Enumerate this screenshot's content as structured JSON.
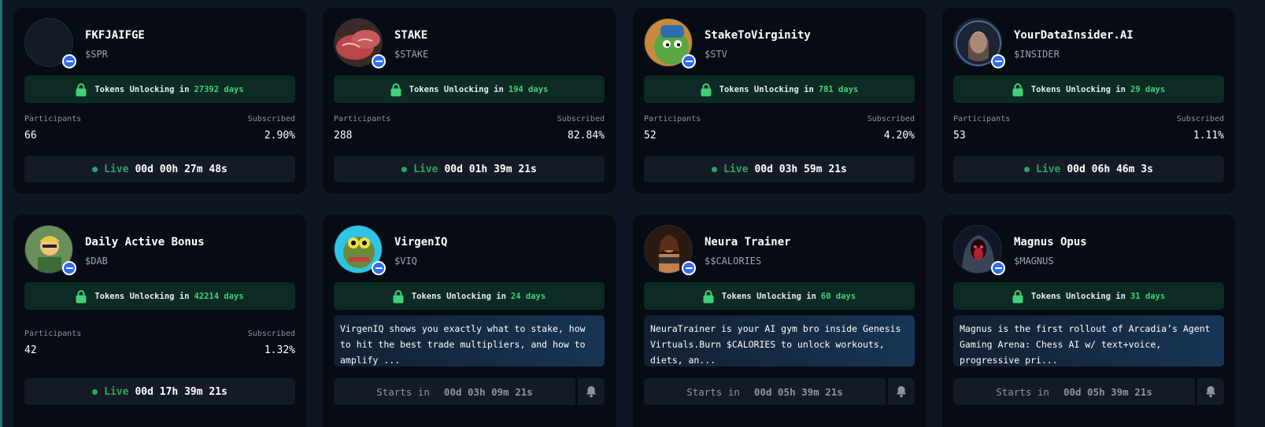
{
  "labels": {
    "unlock_prefix": "Tokens Unlocking in",
    "participants": "Participants",
    "subscribed": "Subscribed",
    "live": "Live",
    "starts_in": "Starts in"
  },
  "colors": {
    "accent_green": "#3fd279",
    "live_green": "#2ea35d",
    "chain_blue": "#2f6cf5"
  },
  "cards": [
    {
      "name": "FKFJAIFGE",
      "ticker": "$SPR",
      "unlock_days": "27392 days",
      "participants": "66",
      "subscribed": "2.90%",
      "countdown": "00d 00h 27m 48s",
      "status": "live",
      "avatar_icon": "blank-avatar"
    },
    {
      "name": "STAKE",
      "ticker": "$STAKE",
      "unlock_days": "194 days",
      "participants": "288",
      "subscribed": "82.84%",
      "countdown": "00d 01h 39m 21s",
      "status": "live",
      "avatar_icon": "steak-avatar"
    },
    {
      "name": "StakeToVirginity",
      "ticker": "$STV",
      "unlock_days": "781 days",
      "participants": "52",
      "subscribed": "4.20%",
      "countdown": "00d 03h 59m 21s",
      "status": "live",
      "avatar_icon": "pepe-avatar"
    },
    {
      "name": "YourDataInsider.AI",
      "ticker": "$INSIDER",
      "unlock_days": "29 days",
      "participants": "53",
      "subscribed": "1.11%",
      "countdown": "00d 06h 46m 3s",
      "status": "live",
      "avatar_icon": "ai-woman-avatar"
    },
    {
      "name": "Daily Active Bonus",
      "ticker": "$DAB",
      "unlock_days": "42214 days",
      "participants": "42",
      "subscribed": "1.32%",
      "countdown": "00d 17h 39m 21s",
      "status": "live",
      "avatar_icon": "cartoon-man-avatar"
    },
    {
      "name": "VirgenIQ",
      "ticker": "$VIQ",
      "unlock_days": "24 days",
      "description": "VirgenIQ shows you exactly what to stake, how to hit the best trade multipliers, and how to amplify ...",
      "countdown": "00d 03h 09m 21s",
      "status": "upcoming",
      "avatar_icon": "frog-avatar"
    },
    {
      "name": "Neura Trainer",
      "ticker": "$$CALORIES",
      "unlock_days": "60 days",
      "description": "NeuraTrainer is your AI gym bro inside Genesis Virtuals.Burn $CALORIES to unlock workouts, diets, an...",
      "countdown": "00d 05h 39m 21s",
      "status": "upcoming",
      "avatar_icon": "trainer-avatar"
    },
    {
      "name": "Magnus Opus",
      "ticker": "$MAGNUS",
      "unlock_days": "31 days",
      "description": "Magnus is the first rollout of Arcadia’s Agent Gaming Arena: Chess AI w/ text+voice, progressive pri...",
      "countdown": "00d 05h 39m 21s",
      "status": "upcoming",
      "avatar_icon": "hooded-figure-avatar"
    }
  ]
}
